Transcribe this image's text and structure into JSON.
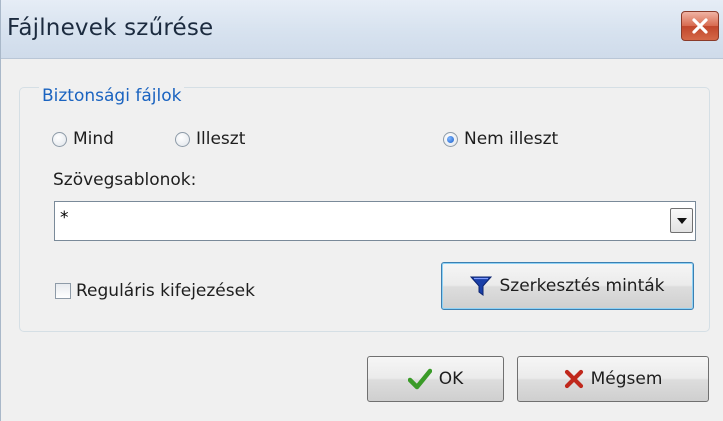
{
  "window": {
    "title": "Fájlnevek szűrése"
  },
  "group": {
    "legend": "Biztonsági fájlok",
    "radios": [
      {
        "label": "Mind",
        "checked": false
      },
      {
        "label": "Illeszt",
        "checked": false
      },
      {
        "label": "Nem illeszt",
        "checked": true
      }
    ],
    "patterns_label": "Szövegsablonok:",
    "pattern_value": "*",
    "regex_label": "Reguláris kifejezések",
    "regex_checked": false,
    "edit_patterns_label": "Szerkesztés minták"
  },
  "footer": {
    "ok_label": "OK",
    "cancel_label": "Mégsem"
  },
  "icons": {
    "close": "close-icon",
    "dropdown": "chevron-down-icon",
    "edit_patterns": "filter-icon",
    "ok": "checkmark-icon",
    "cancel": "cross-icon"
  },
  "colors": {
    "legend_text": "#1a63c0",
    "close_button": "#c1462b",
    "ok_check": "#3a9b28",
    "cancel_cross": "#c0281c",
    "filter_icon": "#1a3fa8"
  }
}
